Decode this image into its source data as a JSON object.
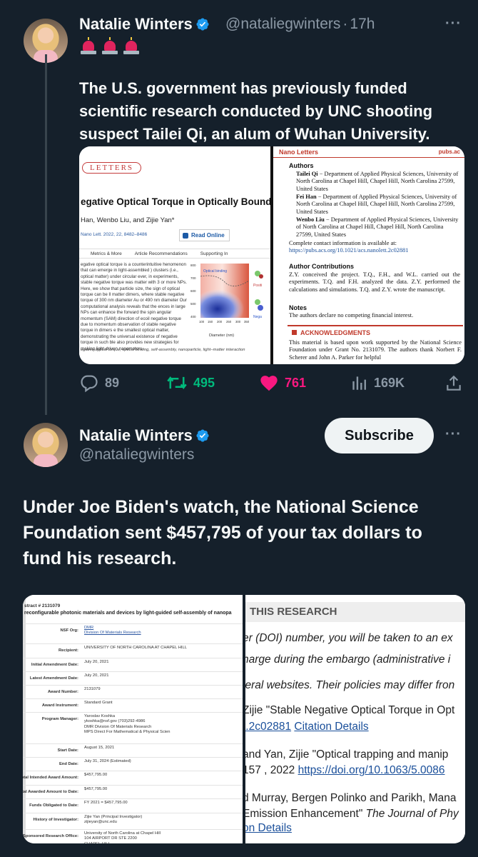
{
  "tweet1": {
    "name": "Natalie Winters",
    "handle": "@nataliegwinters",
    "separator": "·",
    "time": "17h",
    "emoji": [
      "🚨",
      "🚨",
      "🚨"
    ],
    "text": "The U.S. government has previously funded scientific research conducted by UNC shooting suspect Tailei Qi, an alum of Wuhan University.",
    "media_left": {
      "journal_logo": "LETTERS",
      "title": "egative Optical Torque in Optically Bound Nanopa",
      "authors": "Han, Wenbo Liu, and Zijie Yan*",
      "cite": "Nano Lett. 2022, 22, 8482–8486",
      "read_online": "Read Online",
      "tabs": [
        "Metrics & More",
        "Article Recommendations",
        "Supporting In"
      ],
      "abstract": "egative optical torque is a counterintuitive henomenon that can emerge in light-assembled ) clusters (i.e., optical matter) under circular ever, in experiments, stable negative torque was matter with 3 or more NPs. Here, we show that particle size, the sign of optical torque can be ll matter dimers, where stable negative torque of 300 nm diameter Au or 490 nm diameter Our computational analysis reveals that the ences in large NPs can enhance the forward the spin angular momentum (SAM) direction of ecoil negative torque due to momentum observation of stable negative torque in dimers e the smallest optical matter, demonstrating the universal existence of negative torque in such ble also provides new strategies for making light-driven nanomotors.",
      "plot_label": "Optical binding",
      "plot_xlabel": "Diameter (nm)",
      "plot_ylabel": "Separation (nm)",
      "plot_xticks": [
        "100",
        "150",
        "200",
        "250",
        "300",
        "350"
      ],
      "plot_yticks": [
        "800",
        "700",
        "600",
        "500",
        "400"
      ],
      "plot_side_labels": [
        "Positi",
        "Nega"
      ],
      "keywords": "egative optical torque, optical binding, self-assembly, nanoparticle, light−matter interaction"
    },
    "media_right": {
      "journal": "Nano Letters",
      "site": "pubs.ac",
      "authors_head": "Authors",
      "authors": [
        {
          "name": "Tailei Qi",
          "aff": " − Department of Applied Physical Sciences, University of North Carolina at Chapel Hill, Chapel Hill, North Carolina 27599, United States"
        },
        {
          "name": "Fei Han",
          "aff": " − Department of Applied Physical Sciences, University of North Carolina at Chapel Hill, Chapel Hill, North Carolina 27599, United States"
        },
        {
          "name": "Wenbo Liu",
          "aff": " − Department of Applied Physical Sciences, University of North Carolina at Chapel Hill, Chapel Hill, North Carolina 27599, United States"
        }
      ],
      "contact": "Complete contact information is available at:",
      "contact_link": "https://pubs.acs.org/10.1021/acs.nanolett.2c02881",
      "contrib_head": "Author Contributions",
      "contrib": "Z.Y. conceived the project. T.Q., F.H., and W.L. carried out the experiments. T.Q. and F.H. analyzed the data. Z.Y. performed the calculations and simulations. T.Q. and Z.Y. wrote the manuscript.",
      "notes_head": "Notes",
      "notes": "The authors declare no competing financial interest.",
      "ack_head": "ACKNOWLEDGMENTS",
      "ack": "This material is based upon work supported by the National Science Foundation under Grant No. 2131079. The authors thank Norbert F. Scherer and John A. Parker for helpful"
    },
    "stats": {
      "replies": "89",
      "reposts": "495",
      "likes": "761",
      "views": "169K"
    }
  },
  "tweet2": {
    "name": "Natalie Winters",
    "handle": "@nataliegwinters",
    "subscribe": "Subscribe",
    "text": "Under Joe Biden's watch, the National Science Foundation sent $457,795 of your tax dollars to fund his research.",
    "nsf": {
      "header1": "stract # 2131079",
      "header2": " reconfigurable photonic materials and devices by light-guided self-assembly of nanopa",
      "rows": [
        {
          "label": "NSF Org:",
          "value": "DMR\nDivision Of Materials Research",
          "link": true
        },
        {
          "label": "Recipient:",
          "value": "UNIVERSITY OF NORTH CAROLINA AT CHAPEL HILL",
          "link": false
        },
        {
          "label": "Initial Amendment Date:",
          "value": "July 20, 2021",
          "link": false
        },
        {
          "label": "Latest Amendment Date:",
          "value": "July 20, 2021",
          "link": false
        },
        {
          "label": "Award Number:",
          "value": "2131079",
          "link": false
        },
        {
          "label": "Award Instrument:",
          "value": "Standard Grant",
          "link": false
        },
        {
          "label": "Program Manager:",
          "value": "Yaroslav Koshka\nykoshka@nsf.gov  (703)292-4986\nDMR  Division Of Materials Research\nMPS  Direct For Mathematical & Physical Scien",
          "link": false
        },
        {
          "label": "Start Date:",
          "value": "August 15, 2021",
          "link": false
        },
        {
          "label": "End Date:",
          "value": "July 31, 2024 (Estimated)",
          "link": false
        },
        {
          "label": "otal Intended Award Amount:",
          "value": "$457,795.00",
          "link": false
        },
        {
          "label": "tal Awarded Amount to Date:",
          "value": "$457,795.00",
          "link": false
        },
        {
          "label": "Funds Obligated to Date:",
          "value": "FY 2021 = $457,795.00",
          "link": false
        },
        {
          "label": "History of Investigator:",
          "value": "Zijie Yan (Principal Investigator)\nzijieyan@unc.edu",
          "link": false
        },
        {
          "label": "t Sponsored Research Office:",
          "value": "University of North Carolina at Chapel Hill\n104 AIRPORT DR STE 2200\nCHAPEL HILL\nNC  US  27599-5023\n(919)966-3411",
          "link": false
        }
      ]
    },
    "research": {
      "title": "THIS RESEARCH",
      "lines": [
        "er (DOI) number, you will be taken to an ex",
        "harge during the embargo (administrative i",
        "leral websites. Their policies may differ fron",
        "Zijie \"Stable Negative Optical Torque in Opt",
        "t.2c02881",
        "Citation Details",
        "and Yan, Zijie \"Optical trapping and manip",
        "157 , 2022",
        "https://doi.org/10.1063/5.0086",
        "d Murray, Bergen Polinko and Parikh, Mana",
        "Emission Enhancement\"",
        "The Journal of Phy",
        "on Details"
      ]
    }
  },
  "colors": {
    "background": "#15202b",
    "text": "#f7f9f9",
    "muted": "#8b98a5",
    "verified": "#1d9bf0",
    "repost": "#00ba7c",
    "like": "#f91880"
  }
}
